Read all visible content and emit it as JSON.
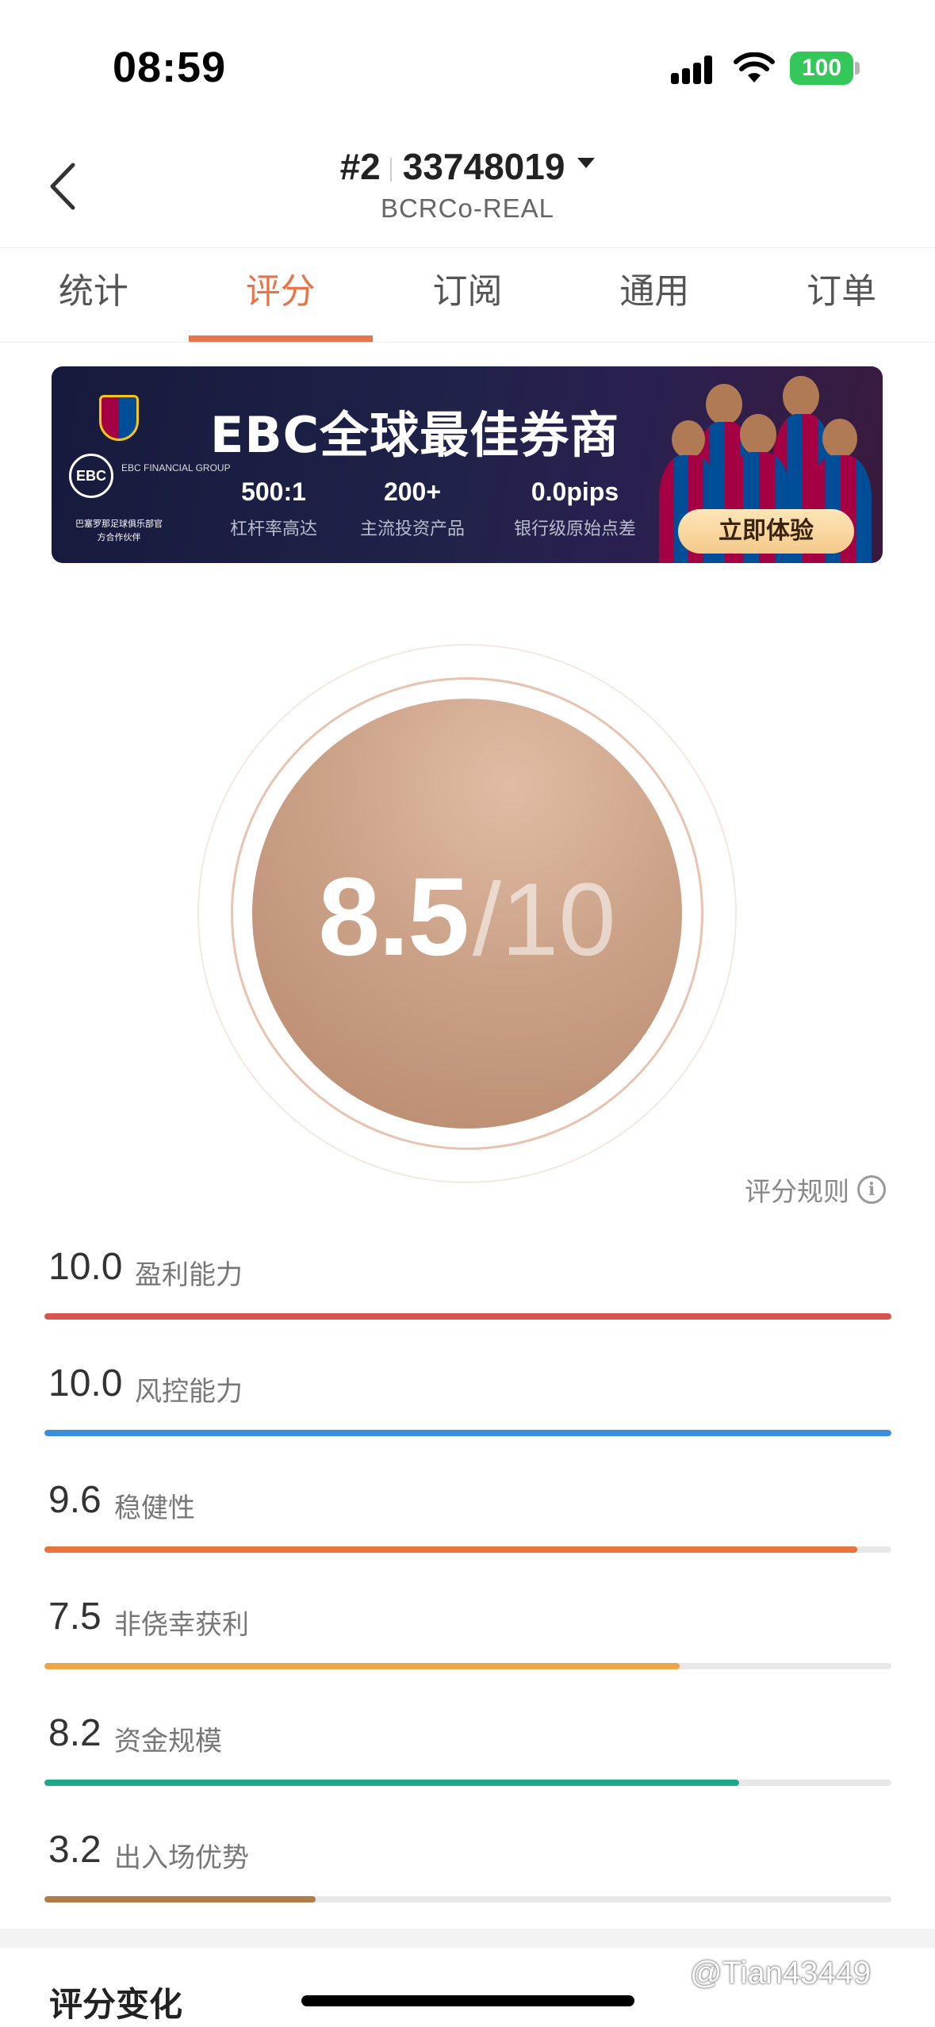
{
  "status_bar": {
    "time": "08:59",
    "battery": "100"
  },
  "header": {
    "rank": "#2",
    "account": "33748019",
    "subtitle": "BCRCo-REAL"
  },
  "tabs": [
    {
      "label": "统计",
      "active": false
    },
    {
      "label": "评分",
      "active": true
    },
    {
      "label": "订阅",
      "active": false
    },
    {
      "label": "通用",
      "active": false
    },
    {
      "label": "订单",
      "active": false
    }
  ],
  "banner": {
    "title": "EBC全球最佳券商",
    "logo_text": "EBC",
    "logo_name": "EBC FINANCIAL GROUP",
    "partner_text": "巴塞罗那足球俱乐部官方合作伙伴",
    "stats": [
      {
        "value": "500:1",
        "label": "杠杆率高达"
      },
      {
        "value": "200+",
        "label": "主流投资产品"
      },
      {
        "value": "0.0pips",
        "label": "银行级原始点差"
      }
    ],
    "cta": "立即体验"
  },
  "score": {
    "value": "8.5",
    "separator": "/",
    "max": "10"
  },
  "rules_link": "评分规则",
  "metrics": [
    {
      "value": "10.0",
      "label": "盈利能力",
      "fraction": 1.0,
      "color": "#d9534f"
    },
    {
      "value": "10.0",
      "label": "风控能力",
      "fraction": 1.0,
      "color": "#3c8dde"
    },
    {
      "value": "9.6",
      "label": "稳健性",
      "fraction": 0.96,
      "color": "#e8743d"
    },
    {
      "value": "7.5",
      "label": "非侥幸获利",
      "fraction": 0.75,
      "color": "#eca64a"
    },
    {
      "value": "8.2",
      "label": "资金规模",
      "fraction": 0.82,
      "color": "#1fa886"
    },
    {
      "value": "3.2",
      "label": "出入场优势",
      "fraction": 0.32,
      "color": "#b07d4a"
    }
  ],
  "section_title": "评分变化",
  "watermark": "@Tian43449",
  "colors": {
    "accent": "#e8744a"
  }
}
